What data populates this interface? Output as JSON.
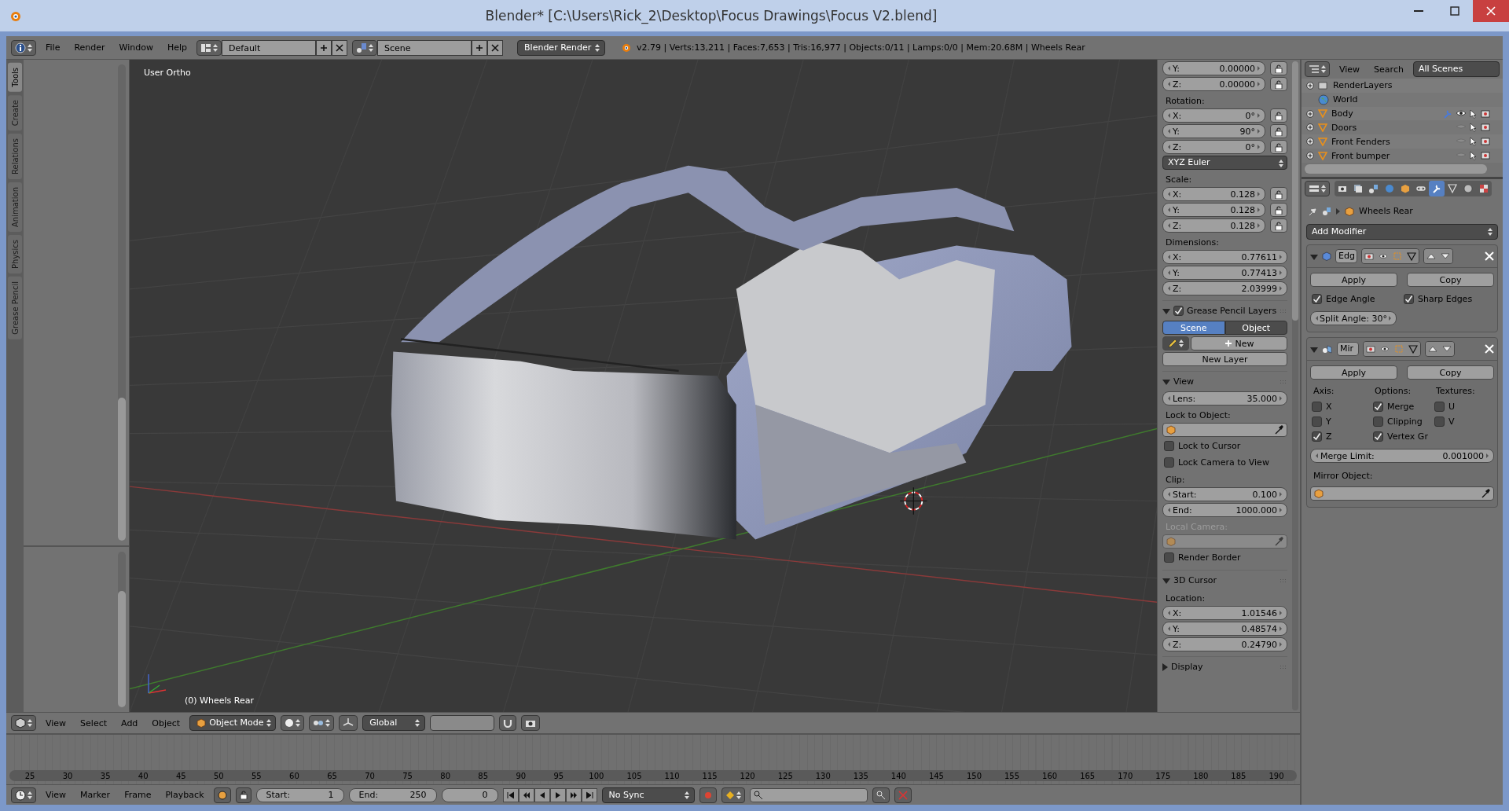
{
  "window": {
    "title": "Blender* [C:\\Users\\Rick_2\\Desktop\\Focus Drawings\\Focus V2.blend]"
  },
  "info_header": {
    "menus": [
      "File",
      "Render",
      "Window",
      "Help"
    ],
    "screen_layout": "Default",
    "scene": "Scene",
    "render_engine": "Blender Render",
    "stats": "v2.79 | Verts:13,211 | Faces:7,653 | Tris:16,977 | Objects:0/11 | Lamps:0/0 | Mem:20.68M | Wheels Rear"
  },
  "tool_tabs": [
    {
      "label": "Tools",
      "selected": true
    },
    {
      "label": "Create",
      "selected": false
    },
    {
      "label": "Relations",
      "selected": false
    },
    {
      "label": "Animation",
      "selected": false
    },
    {
      "label": "Physics",
      "selected": false
    },
    {
      "label": "Grease Pencil",
      "selected": false
    }
  ],
  "viewport": {
    "view_label": "User Ortho",
    "object_label": "(0) Wheels Rear"
  },
  "properties_region": [
    {
      "kind": "field",
      "label": "Y:",
      "value": "0.00000",
      "lock": true
    },
    {
      "kind": "field",
      "label": "Z:",
      "value": "0.00000",
      "lock": true
    },
    {
      "kind": "label",
      "text": "Rotation:",
      "disabled": false
    },
    {
      "kind": "field",
      "label": "X:",
      "value": "0°",
      "lock": true
    },
    {
      "kind": "field",
      "label": "Y:",
      "value": "90°",
      "lock": true
    },
    {
      "kind": "field",
      "label": "Z:",
      "value": "0°",
      "lock": true
    },
    {
      "kind": "dropdown",
      "value": "XYZ Euler"
    },
    {
      "kind": "label",
      "text": "Scale:",
      "disabled": false
    },
    {
      "kind": "field",
      "label": "X:",
      "value": "0.128",
      "lock": true
    },
    {
      "kind": "field",
      "label": "Y:",
      "value": "0.128",
      "lock": true
    },
    {
      "kind": "field",
      "label": "Z:",
      "value": "0.128",
      "lock": true
    },
    {
      "kind": "label",
      "text": "Dimensions:",
      "disabled": false
    },
    {
      "kind": "field",
      "label": "X:",
      "value": "0.77611",
      "lock": false
    },
    {
      "kind": "field",
      "label": "Y:",
      "value": "0.77413",
      "lock": false
    },
    {
      "kind": "field",
      "label": "Z:",
      "value": "2.03999",
      "lock": false
    },
    {
      "kind": "section",
      "title": "Grease Pencil Layers",
      "expanded": true,
      "checked": true
    },
    {
      "kind": "segmented",
      "options": [
        {
          "label": "Scene",
          "selected": true
        },
        {
          "label": "Object",
          "selected": false
        }
      ]
    },
    {
      "kind": "pencil_new",
      "label": "New"
    },
    {
      "kind": "button",
      "label": "New Layer"
    },
    {
      "kind": "section",
      "title": "View",
      "expanded": true
    },
    {
      "kind": "field",
      "label": "Lens:",
      "value": "35.000",
      "lock": false
    },
    {
      "kind": "label",
      "text": "Lock to Object:",
      "disabled": false
    },
    {
      "kind": "object_field",
      "disabled": false
    },
    {
      "kind": "checkbox",
      "label": "Lock to Cursor",
      "checked": false
    },
    {
      "kind": "checkbox",
      "label": "Lock Camera to View",
      "checked": false
    },
    {
      "kind": "label",
      "text": "Clip:",
      "disabled": false
    },
    {
      "kind": "field",
      "label": "Start:",
      "value": "0.100",
      "lock": false
    },
    {
      "kind": "field",
      "label": "End:",
      "value": "1000.000",
      "lock": false
    },
    {
      "kind": "label",
      "text": "Local Camera:",
      "disabled": true
    },
    {
      "kind": "object_field",
      "disabled": true
    },
    {
      "kind": "checkbox",
      "label": "Render Border",
      "checked": false
    },
    {
      "kind": "section",
      "title": "3D Cursor",
      "expanded": true
    },
    {
      "kind": "label",
      "text": "Location:",
      "disabled": false
    },
    {
      "kind": "field",
      "label": "X:",
      "value": "1.01546",
      "lock": false
    },
    {
      "kind": "field",
      "label": "Y:",
      "value": "0.48574",
      "lock": false
    },
    {
      "kind": "field",
      "label": "Z:",
      "value": "0.24790",
      "lock": false
    },
    {
      "kind": "section",
      "title": "Display",
      "expanded": false
    }
  ],
  "outliner": {
    "menus": [
      "View",
      "Search"
    ],
    "display_mode": "All Scenes",
    "rows": [
      {
        "name": "RenderLayers",
        "kind": "render_layers",
        "expandable": true
      },
      {
        "name": "World",
        "kind": "world",
        "expandable": false
      },
      {
        "name": "Body",
        "kind": "mesh",
        "expandable": true,
        "visible": true,
        "modifier": true
      },
      {
        "name": "Doors",
        "kind": "mesh",
        "expandable": true,
        "visible": false,
        "modifier": false
      },
      {
        "name": "Front Fenders",
        "kind": "mesh",
        "expandable": true,
        "visible": false,
        "modifier": false
      },
      {
        "name": "Front bumper",
        "kind": "mesh",
        "expandable": true,
        "visible": false,
        "modifier": false
      }
    ]
  },
  "properties": {
    "tabs": [
      {
        "kind": "render",
        "selected": false
      },
      {
        "kind": "layers",
        "selected": false
      },
      {
        "kind": "scene",
        "selected": false
      },
      {
        "kind": "world",
        "selected": false
      },
      {
        "kind": "object",
        "selected": false
      },
      {
        "kind": "constraints",
        "selected": false
      },
      {
        "kind": "modifiers",
        "selected": true
      },
      {
        "kind": "data",
        "selected": false
      },
      {
        "kind": "material",
        "selected": false
      },
      {
        "kind": "texture",
        "selected": false
      }
    ],
    "object_name": "Wheels Rear",
    "add_modifier": "Add Modifier",
    "modifiers": [
      {
        "kind": "edge_split",
        "name": "Edg",
        "expanded": true,
        "buttons": [
          "Apply",
          "Copy"
        ],
        "checkboxes": [
          {
            "label": "Edge Angle",
            "checked": true
          },
          {
            "label": "Sharp Edges",
            "checked": true
          }
        ],
        "fields": [
          {
            "label": "Split Angle:",
            "value": "30°"
          }
        ]
      },
      {
        "kind": "mirror",
        "name": "Mir",
        "expanded": true,
        "buttons": [
          "Apply",
          "Copy"
        ],
        "columns": [
          {
            "title": "Axis:",
            "checkboxes": [
              {
                "label": "X",
                "checked": false
              },
              {
                "label": "Y",
                "checked": false
              },
              {
                "label": "Z",
                "checked": true
              }
            ]
          },
          {
            "title": "Options:",
            "checkboxes": [
              {
                "label": "Merge",
                "checked": true
              },
              {
                "label": "Clipping",
                "checked": false
              },
              {
                "label": "Vertex Gr",
                "checked": true
              }
            ]
          },
          {
            "title": "Textures:",
            "checkboxes": [
              {
                "label": "U",
                "checked": false
              },
              {
                "label": "V",
                "checked": false
              }
            ]
          }
        ],
        "wide_fields": [
          {
            "label": "Merge Limit:",
            "value": "0.001000"
          }
        ],
        "object_label": "Mirror Object:"
      }
    ]
  },
  "viewport_header": {
    "menus": [
      "View",
      "Select",
      "Add",
      "Object"
    ],
    "mode": "Object Mode",
    "orientation": "Global"
  },
  "timeline": {
    "ticks": [
      "25",
      "30",
      "35",
      "40",
      "45",
      "50",
      "55",
      "60",
      "65",
      "70",
      "75",
      "80",
      "85",
      "90",
      "95",
      "100",
      "105",
      "110",
      "115",
      "120",
      "125",
      "130",
      "135",
      "140",
      "145",
      "150",
      "155",
      "160",
      "165",
      "170",
      "175",
      "180",
      "185",
      "190"
    ]
  },
  "timeline_header": {
    "menus": [
      "View",
      "Marker",
      "Frame",
      "Playback"
    ],
    "start": {
      "label": "Start:",
      "value": "1"
    },
    "end": {
      "label": "End:",
      "value": "250"
    },
    "current": "0",
    "sync": "No Sync"
  }
}
